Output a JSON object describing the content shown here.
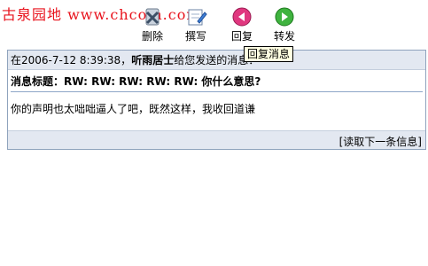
{
  "watermark": "古泉园地 www.chcoin.com",
  "toolbar": {
    "delete_label": "删除",
    "compose_label": "撰写",
    "reply_label": "回复",
    "forward_label": "转发"
  },
  "tooltip": "回复消息",
  "message": {
    "header_prefix": "在2006-7-12 8:39:38，",
    "sender": "听雨居士",
    "header_suffix": "给您发送的消息：",
    "subject_label": "消息标题：",
    "subject": "RW: RW: RW: RW: RW: 你什么意思?",
    "body": "你的声明也太咄咄逼人了吧，既然这样，我收回道谦"
  },
  "footer": {
    "next_link": "[读取下一条信息]"
  }
}
